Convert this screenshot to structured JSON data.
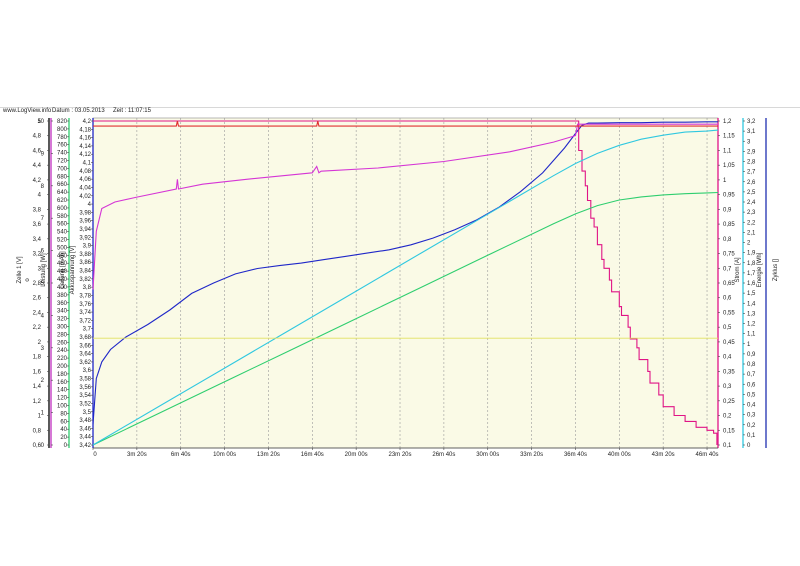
{
  "header": {
    "site": "www.LogView.info",
    "date_label": "Datum : 03.05.2013",
    "time_label": "Zeit : 11:07:15"
  },
  "colors": {
    "plot_bg": "#fafae6",
    "voltage": "#1f27c8",
    "current": "#e01486",
    "charge": "#2fce6f",
    "energy": "#30c8e0",
    "power": "#d535d5",
    "temperature": "#e03030",
    "reference": "#e0e060"
  },
  "chart_data": {
    "type": "line",
    "grid": true,
    "x": {
      "range_seconds": [
        0,
        2850
      ],
      "tick_labels": [
        "0",
        "3m 20s",
        "6m 40s",
        "10m 00s",
        "13m 20s",
        "16m 40s",
        "20m 00s",
        "23m 20s",
        "26m 40s",
        "30m 00s",
        "33m 20s",
        "36m 40s",
        "40m 00s",
        "43m 20s",
        "46m 40s"
      ]
    },
    "axes": [
      {
        "id": "zelle",
        "label": "Zelle 1 [V]",
        "marker": "o",
        "side": "left",
        "color": "#000000",
        "ticks": [
          "5",
          "4,8",
          "4,6",
          "4,4",
          "4,2",
          "4",
          "3,8",
          "3,6",
          "3,4",
          "3,2",
          "3",
          "2,8",
          "2,6",
          "2,4",
          "2,2",
          "2",
          "1,8",
          "1,6",
          "1,4",
          "1,2",
          "1",
          "0,8",
          "0,6"
        ]
      },
      {
        "id": "leistung",
        "label": "Leistung [W]",
        "side": "left",
        "color": "#c030c0",
        "ticks": [
          "10",
          "9",
          "8",
          "7",
          "6",
          "5",
          "4",
          "3",
          "2",
          "1",
          "0"
        ]
      },
      {
        "id": "ladung",
        "label": "Ladung [mAh]",
        "side": "left",
        "color": "#2fce6f",
        "ticks": [
          "820",
          "800",
          "780",
          "760",
          "740",
          "720",
          "700",
          "680",
          "660",
          "640",
          "620",
          "600",
          "580",
          "560",
          "540",
          "520",
          "500",
          "480",
          "460",
          "440",
          "420",
          "400",
          "380",
          "360",
          "340",
          "320",
          "300",
          "280",
          "260",
          "240",
          "220",
          "200",
          "180",
          "160",
          "140",
          "120",
          "100",
          "80",
          "60",
          "40",
          "20",
          "0"
        ]
      },
      {
        "id": "akku",
        "label": "Akkuspannung [V]",
        "side": "left",
        "color": "#1f27c8",
        "ticks": [
          "4,2",
          "4,18",
          "4,16",
          "4,14",
          "4,12",
          "4,1",
          "4,08",
          "4,06",
          "4,04",
          "4,02",
          "4",
          "3,98",
          "3,96",
          "3,94",
          "3,92",
          "3,9",
          "3,88",
          "3,86",
          "3,84",
          "3,82",
          "3,8",
          "3,78",
          "3,76",
          "3,74",
          "3,72",
          "3,7",
          "3,68",
          "3,66",
          "3,64",
          "3,62",
          "3,6",
          "3,58",
          "3,56",
          "3,54",
          "3,52",
          "3,5",
          "3,48",
          "3,46",
          "3,44",
          "3,42"
        ]
      },
      {
        "id": "strom",
        "label": "Strom [A]",
        "side": "right",
        "color": "#e01486",
        "ticks": [
          "1,2",
          "1,15",
          "1,1",
          "1,05",
          "1",
          "0,95",
          "0,9",
          "0,85",
          "0,8",
          "0,75",
          "0,7",
          "0,65",
          "0,6",
          "0,55",
          "0,5",
          "0,45",
          "0,4",
          "0,35",
          "0,3",
          "0,25",
          "0,2",
          "0,15",
          "0,1"
        ]
      },
      {
        "id": "energie",
        "label": "Energie [Wh]",
        "side": "right",
        "color": "#30c8e0",
        "ticks": [
          "3,2",
          "3,1",
          "3",
          "2,9",
          "2,8",
          "2,7",
          "2,6",
          "2,5",
          "2,4",
          "2,3",
          "2,2",
          "2,1",
          "2",
          "1,9",
          "1,8",
          "1,7",
          "1,6",
          "1,5",
          "1,4",
          "1,3",
          "1,2",
          "1,1",
          "1",
          "0,9",
          "0,8",
          "0,7",
          "0,6",
          "0,5",
          "0,4",
          "0,3",
          "0,2",
          "0,1",
          "0"
        ]
      },
      {
        "id": "zyklus",
        "label": "Zyklus []",
        "side": "right",
        "color": "#2030b0",
        "ticks": []
      }
    ],
    "series": [
      {
        "key": "akkuspannung",
        "axis": "akku",
        "unit": "V",
        "x": [
          0,
          15,
          40,
          80,
          150,
          250,
          350,
          450,
          550,
          650,
          750,
          850,
          950,
          1050,
          1150,
          1250,
          1350,
          1450,
          1550,
          1650,
          1750,
          1850,
          1950,
          2050,
          2150,
          2200,
          2230,
          2260,
          2300,
          2400,
          2500,
          2600,
          2700,
          2800,
          2850
        ],
        "y": [
          3.47,
          3.58,
          3.62,
          3.65,
          3.68,
          3.71,
          3.745,
          3.785,
          3.81,
          3.832,
          3.845,
          3.852,
          3.858,
          3.866,
          3.874,
          3.882,
          3.89,
          3.902,
          3.918,
          3.938,
          3.962,
          3.992,
          4.03,
          4.075,
          4.135,
          4.17,
          4.19,
          4.195,
          4.195,
          4.196,
          4.196,
          4.197,
          4.197,
          4.198,
          4.198
        ]
      },
      {
        "key": "strom",
        "axis": "strom",
        "unit": "A",
        "x": [
          0,
          2200,
          2215,
          2230,
          2245,
          2255,
          2270,
          2285,
          2300,
          2320,
          2330,
          2355,
          2365,
          2400,
          2410,
          2440,
          2450,
          2480,
          2490,
          2530,
          2540,
          2580,
          2600,
          2650,
          2700,
          2750,
          2800,
          2830,
          2845
        ],
        "y": [
          1.2,
          1.2,
          1.1,
          1.03,
          0.98,
          0.93,
          0.87,
          0.84,
          0.78,
          0.73,
          0.7,
          0.66,
          0.62,
          0.57,
          0.54,
          0.5,
          0.46,
          0.43,
          0.39,
          0.35,
          0.31,
          0.27,
          0.23,
          0.2,
          0.18,
          0.16,
          0.15,
          0.14,
          0.1
        ]
      },
      {
        "key": "ladung",
        "axis": "ladung",
        "unit": "mAh",
        "x": [
          0,
          300,
          600,
          900,
          1200,
          1500,
          1800,
          2100,
          2200,
          2300,
          2400,
          2500,
          2600,
          2700,
          2800,
          2850
        ],
        "y": [
          0,
          80,
          160,
          240,
          320,
          400,
          480,
          560,
          585,
          606,
          620,
          628,
          633,
          636,
          638,
          639
        ]
      },
      {
        "key": "energie",
        "axis": "energie",
        "unit": "Wh",
        "x": [
          0,
          300,
          600,
          900,
          1200,
          1500,
          1800,
          2100,
          2200,
          2300,
          2400,
          2500,
          2600,
          2700,
          2800,
          2850
        ],
        "y": [
          0,
          0.38,
          0.76,
          1.14,
          1.52,
          1.9,
          2.28,
          2.66,
          2.78,
          2.88,
          2.96,
          3.02,
          3.06,
          3.09,
          3.1,
          3.11
        ]
      },
      {
        "key": "leistung",
        "axis": "leistung",
        "unit": "W",
        "x": [
          0,
          15,
          40,
          100,
          200,
          380,
          385,
          390,
          500,
          700,
          1000,
          1020,
          1030,
          1040,
          1300,
          1600,
          1900,
          2100,
          2200,
          2210,
          2850
        ],
        "y": [
          4.8,
          6.6,
          7.3,
          7.5,
          7.65,
          7.9,
          8.2,
          7.9,
          8.05,
          8.2,
          8.4,
          8.6,
          8.4,
          8.45,
          8.55,
          8.75,
          9.05,
          9.35,
          9.55,
          9.9,
          9.9
        ]
      },
      {
        "key": "temperatur",
        "unit": "",
        "x": [
          0,
          380,
          385,
          390,
          1020,
          1025,
          1030,
          2200,
          2850
        ],
        "y": [
          0.983,
          0.983,
          1,
          0.983,
          0.983,
          1,
          0.983,
          0.983,
          0.983
        ]
      },
      {
        "key": "referenz",
        "axis": "zelle",
        "unit": "V",
        "x": [
          0,
          2850
        ],
        "y": [
          2.05,
          2.05
        ]
      }
    ]
  }
}
